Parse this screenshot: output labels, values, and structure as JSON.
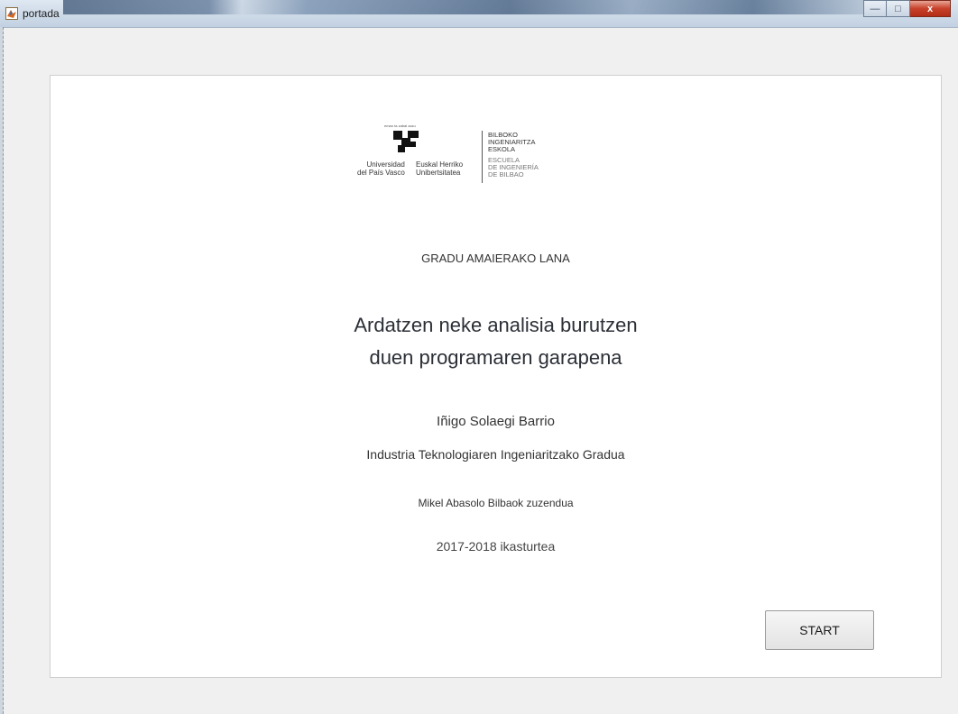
{
  "window": {
    "title": "portada",
    "minimize_glyph": "—",
    "maximize_glyph": "□",
    "close_glyph": "x"
  },
  "logo": {
    "tagline": "eman ta zabal zazu",
    "university_es_line1": "Universidad",
    "university_es_line2": "del País Vasco",
    "university_eu_line1": "Euskal Herriko",
    "university_eu_line2": "Unibertsitatea",
    "school_eu_line1": "BILBOKO",
    "school_eu_line2": "INGENIARITZA",
    "school_eu_line3": "ESKOLA",
    "school_es_line1": "ESCUELA",
    "school_es_line2": "DE INGENIERÍA",
    "school_es_line3": "DE BILBAO"
  },
  "content": {
    "label": "GRADU AMAIERAKO LANA",
    "title_line1": "Ardatzen neke analisia burutzen",
    "title_line2": "duen programaren garapena",
    "author": "Iñigo Solaegi Barrio",
    "degree": "Industria Teknologiaren Ingeniaritzako Gradua",
    "director": "Mikel Abasolo Bilbaok zuzendua",
    "year": "2017-2018 ikasturtea"
  },
  "actions": {
    "start_label": "START"
  }
}
